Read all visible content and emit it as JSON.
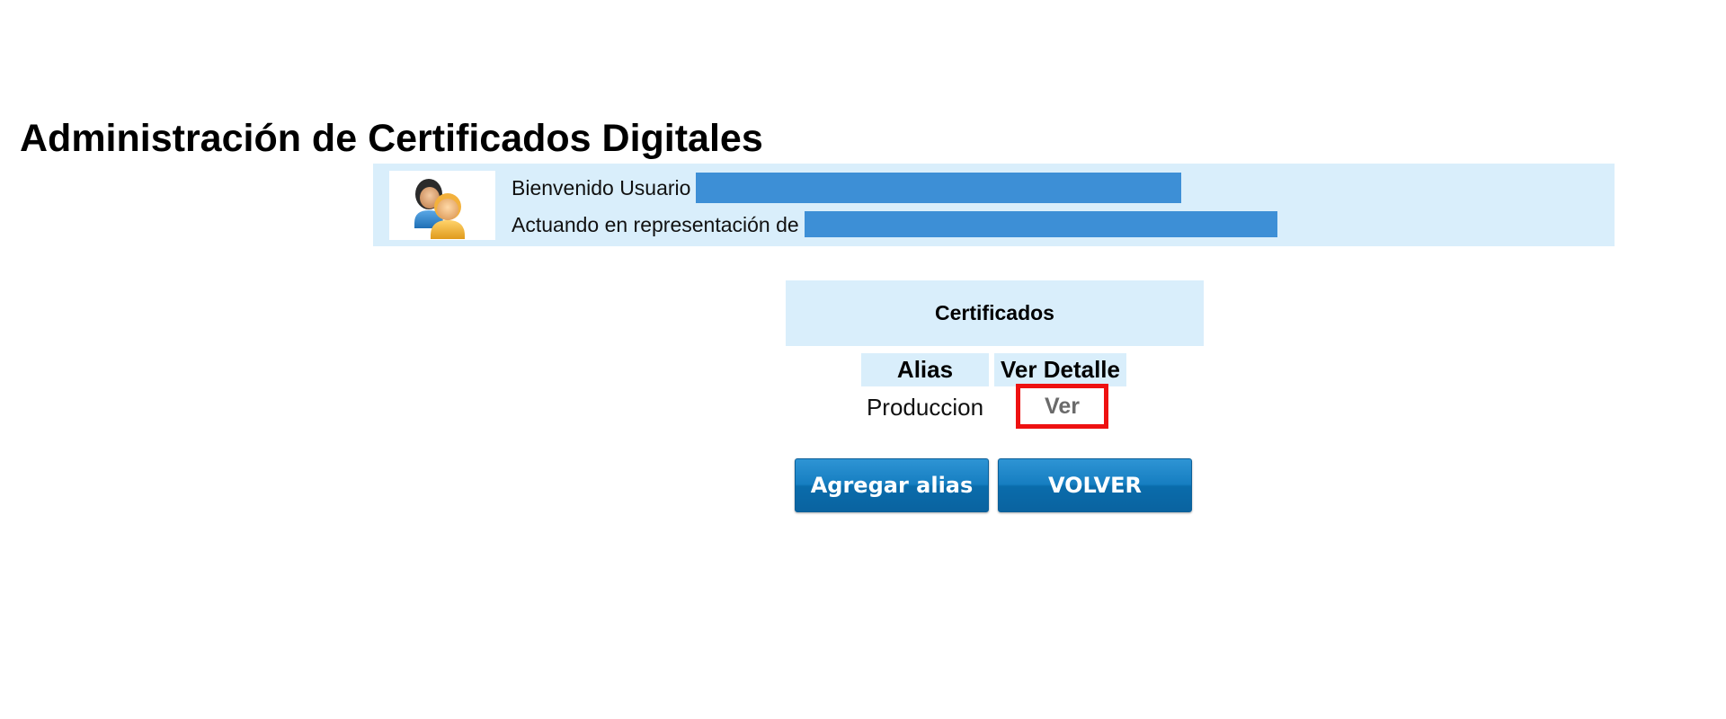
{
  "page": {
    "title": "Administración de Certificados Digitales"
  },
  "user_banner": {
    "welcome_label": "Bienvenido Usuario",
    "representation_label": "Actuando en representación de",
    "avatar_icon": "users-icon",
    "redaction_color": "#3d8fd6",
    "background_color": "#d9eefb"
  },
  "certificates": {
    "header": "Certificados",
    "columns": [
      "Alias",
      "Ver Detalle"
    ],
    "rows": [
      {
        "alias": "Produccion",
        "detail_link": "Ver"
      }
    ]
  },
  "actions": {
    "add_alias_label": "Agregar alias",
    "back_label": "VOLVER",
    "button_color": "#167ec1"
  },
  "highlight": {
    "color": "#ee1111",
    "target": "Ver"
  }
}
